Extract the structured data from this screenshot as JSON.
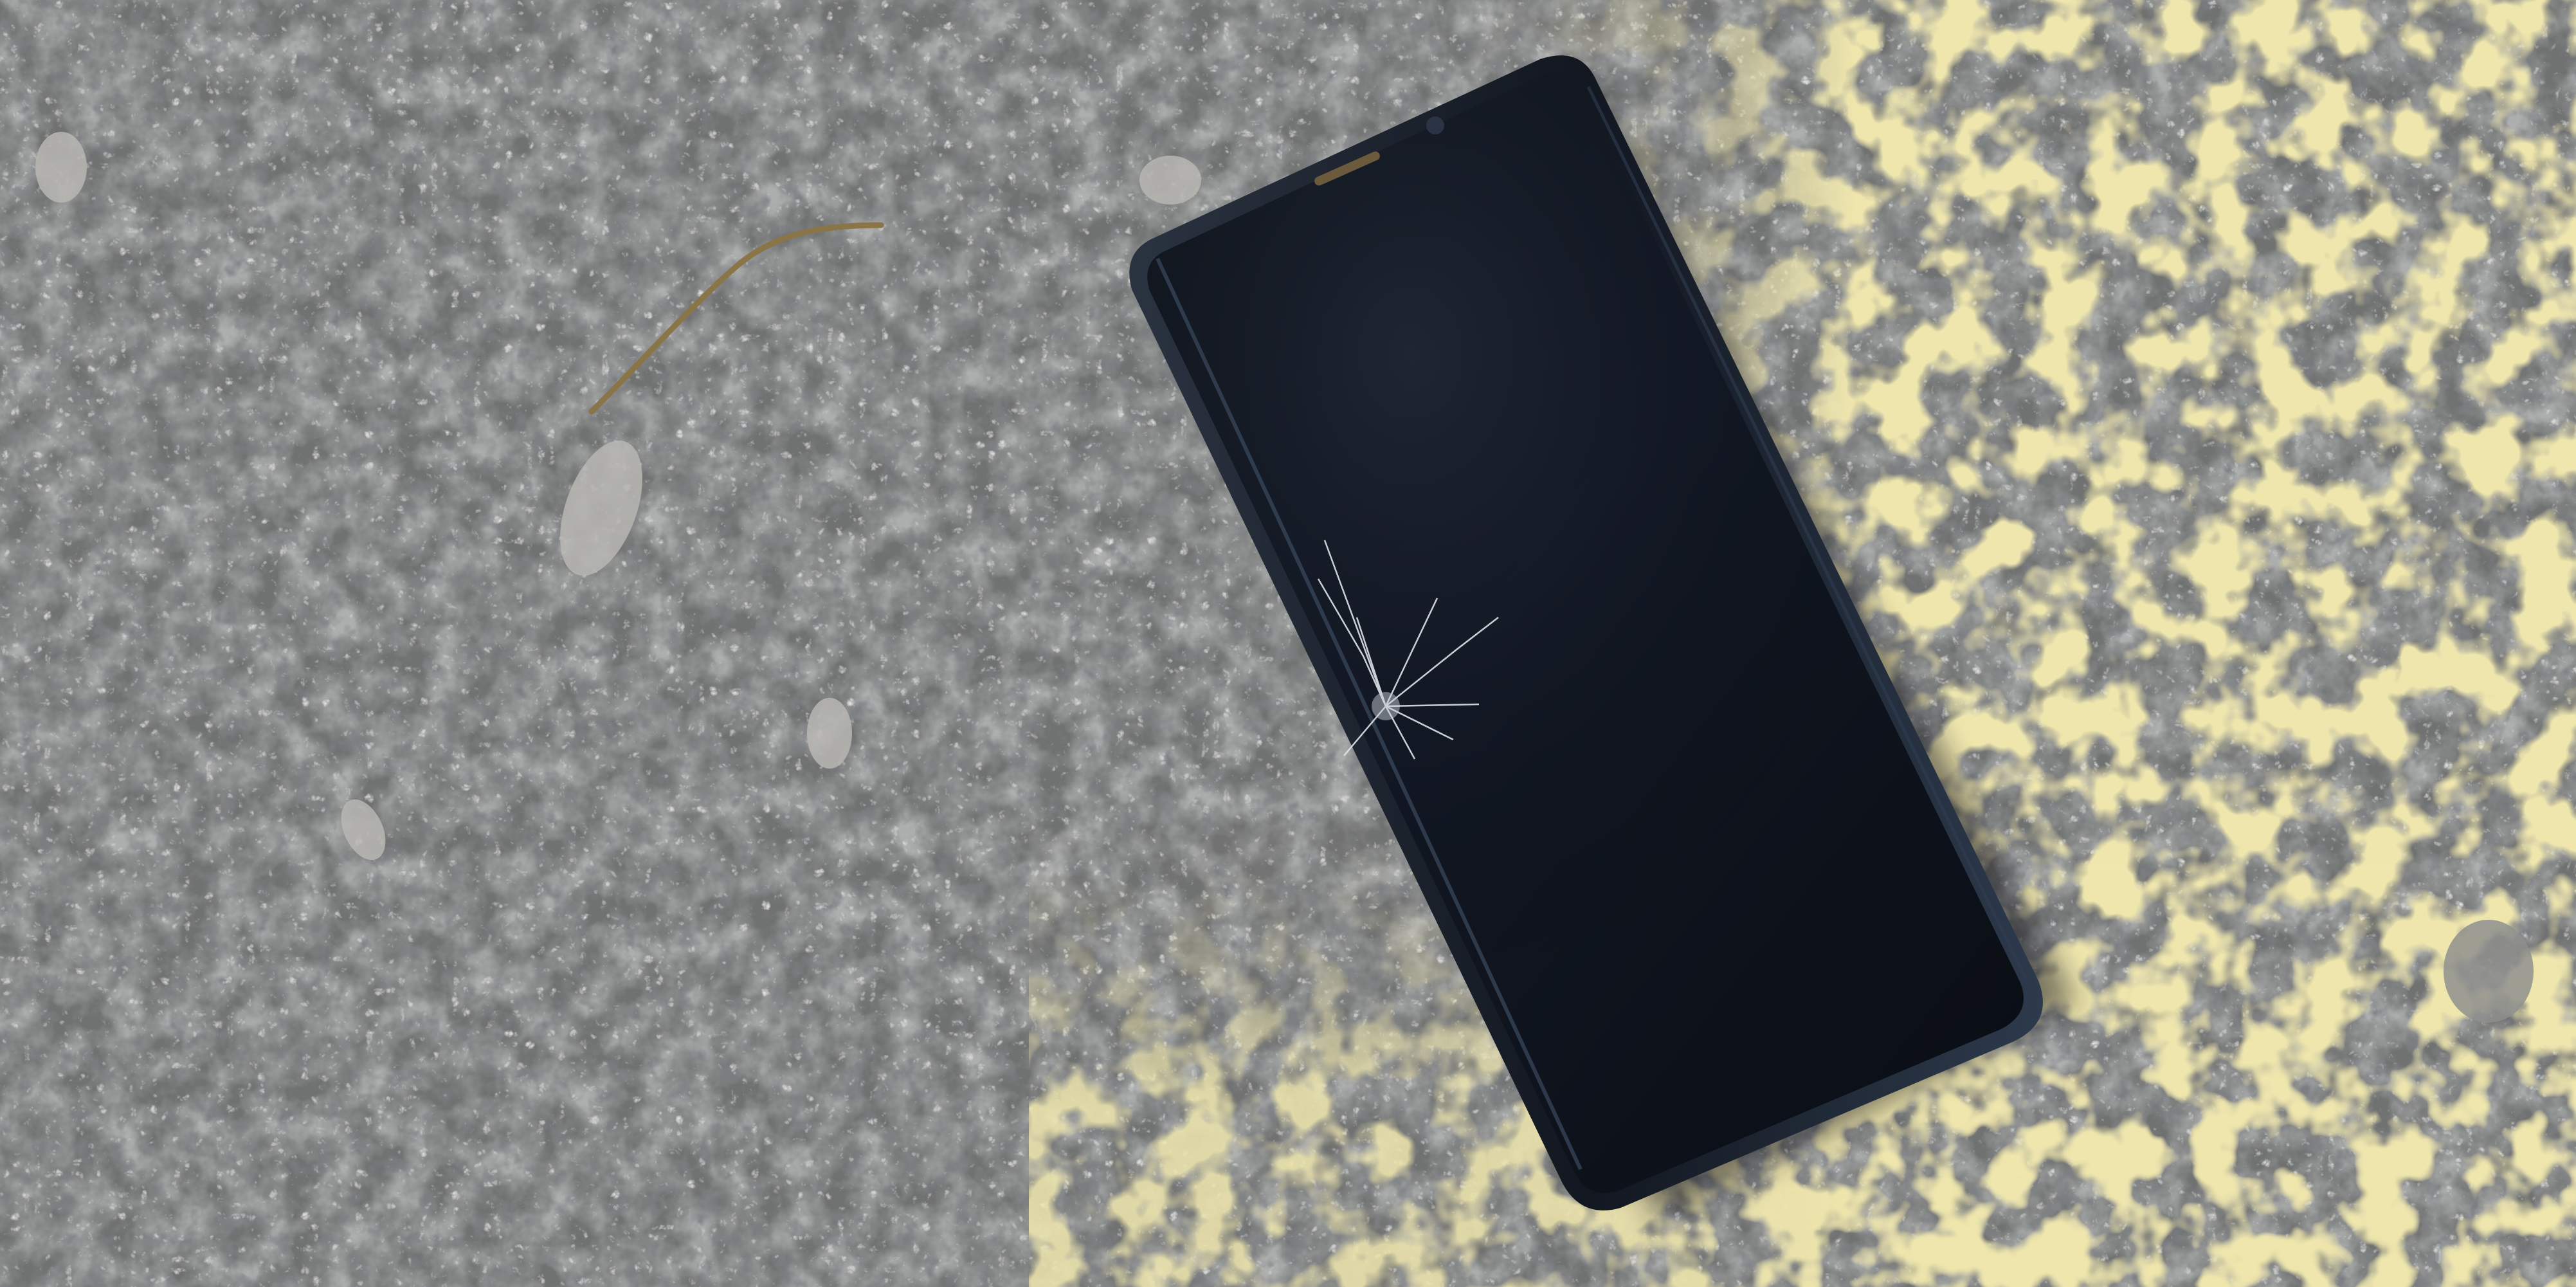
{
  "scene": {
    "subject": "smartphone",
    "screen_state": "off",
    "screen_damage": "cracked",
    "surface": "asphalt",
    "paint_marking": "yellow"
  },
  "colors": {
    "asphalt_base": "#6f7070",
    "asphalt_dark": "#4f5152",
    "asphalt_light": "#9a9b9a",
    "yellow_paint": "#dccb6a",
    "yellow_paint_light": "#ece0a0",
    "phone_frame": "#141820",
    "phone_screen": "#0d1118",
    "phone_screen_highlight": "#2a3140",
    "crack": "#d8dde4",
    "twig": "#8a7548"
  }
}
